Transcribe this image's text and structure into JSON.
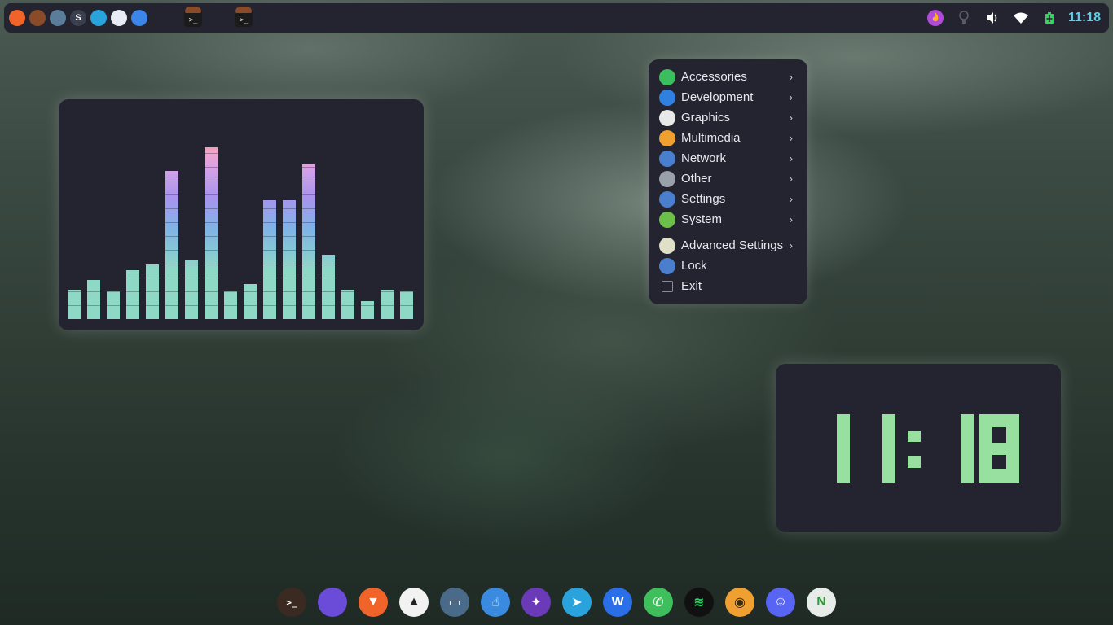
{
  "top_panel": {
    "launchers": [
      {
        "icon": "brave-icon",
        "color": "#f0642a"
      },
      {
        "icon": "terminal-icon",
        "color": "#8a4b2b"
      },
      {
        "icon": "remote-desktop-icon",
        "color": "#5a7d9a"
      },
      {
        "icon": "skype-icon",
        "color": "#3a3f4f",
        "glyph": "S"
      },
      {
        "icon": "telegram-icon",
        "color": "#2aa3dd"
      },
      {
        "icon": "cube-icon",
        "color": "#e8ecf4"
      },
      {
        "icon": "files-icon",
        "color": "#3b86e8"
      }
    ],
    "tasks": [
      {
        "icon": "terminal-task-icon",
        "glyph": ">_"
      },
      {
        "icon": "terminal-task-icon",
        "glyph": ">_"
      }
    ],
    "tray": {
      "icons": [
        "flame-icon",
        "bulb-icon",
        "volume-icon",
        "wifi-icon",
        "battery-icon"
      ],
      "clock": "11:18"
    }
  },
  "menu": {
    "items": [
      {
        "label": "Accessories",
        "icon": "accessories-icon",
        "color": "#3bbf5e",
        "submenu": true
      },
      {
        "label": "Development",
        "icon": "development-icon",
        "color": "#2f80e0",
        "submenu": true
      },
      {
        "label": "Graphics",
        "icon": "graphics-icon",
        "color": "#e8e8e8",
        "submenu": true
      },
      {
        "label": "Multimedia",
        "icon": "multimedia-icon",
        "color": "#f0a030",
        "submenu": true
      },
      {
        "label": "Network",
        "icon": "network-icon",
        "color": "#4a7fd0",
        "submenu": true
      },
      {
        "label": "Other",
        "icon": "other-icon",
        "color": "#9aa0aa",
        "submenu": true
      },
      {
        "label": "Settings",
        "icon": "settings-icon",
        "color": "#4a7fd0",
        "submenu": true
      },
      {
        "label": "System",
        "icon": "system-icon",
        "color": "#6cc04a",
        "submenu": true
      }
    ],
    "extra_items": [
      {
        "label": "Advanced Settings",
        "icon": "advanced-settings-icon",
        "color": "#e0e0c8",
        "submenu": true
      },
      {
        "label": "Lock",
        "icon": "lock-icon",
        "color": "#4a7fd0",
        "submenu": false
      },
      {
        "label": "Exit",
        "icon": "exit-icon",
        "color": "#23242f",
        "submenu": false
      }
    ],
    "arrow": "›"
  },
  "visualizer": {
    "levels": [
      0.15,
      0.2,
      0.14,
      0.25,
      0.28,
      0.76,
      0.3,
      0.88,
      0.14,
      0.18,
      0.61,
      0.61,
      0.79,
      0.33,
      0.15,
      0.09,
      0.15,
      0.14
    ]
  },
  "digital_clock": {
    "time": "11:18"
  },
  "dock": {
    "apps": [
      {
        "name": "terminal-dock-icon",
        "color": "#3a2a22",
        "glyph": ">_"
      },
      {
        "name": "files-dock-icon",
        "color": "#6a4cd8",
        "glyph": ""
      },
      {
        "name": "brave-dock-icon",
        "color": "#f0642a",
        "glyph": "▼"
      },
      {
        "name": "inkscape-dock-icon",
        "color": "#f2f2f2",
        "glyph": "▲"
      },
      {
        "name": "remote-desktop-dock-icon",
        "color": "#4a6a8a",
        "glyph": "▭"
      },
      {
        "name": "touch-dock-icon",
        "color": "#3a8ae0",
        "glyph": "☝"
      },
      {
        "name": "firefox-dock-icon",
        "color": "#6a3ab8",
        "glyph": "✦"
      },
      {
        "name": "telegram-dock-icon",
        "color": "#2aa3dd",
        "glyph": "➤"
      },
      {
        "name": "wps-dock-icon",
        "color": "#2b6fe8",
        "glyph": "W"
      },
      {
        "name": "whatsapp-dock-icon",
        "color": "#3fbf5c",
        "glyph": "✆"
      },
      {
        "name": "spotify-dock-icon",
        "color": "#1ed760",
        "glyph": "≋"
      },
      {
        "name": "audacious-dock-icon",
        "color": "#f0a030",
        "glyph": "◉"
      },
      {
        "name": "discord-dock-icon",
        "color": "#5865f2",
        "glyph": "☺"
      },
      {
        "name": "neovim-dock-icon",
        "color": "#e8ece8",
        "glyph": "N"
      }
    ]
  }
}
